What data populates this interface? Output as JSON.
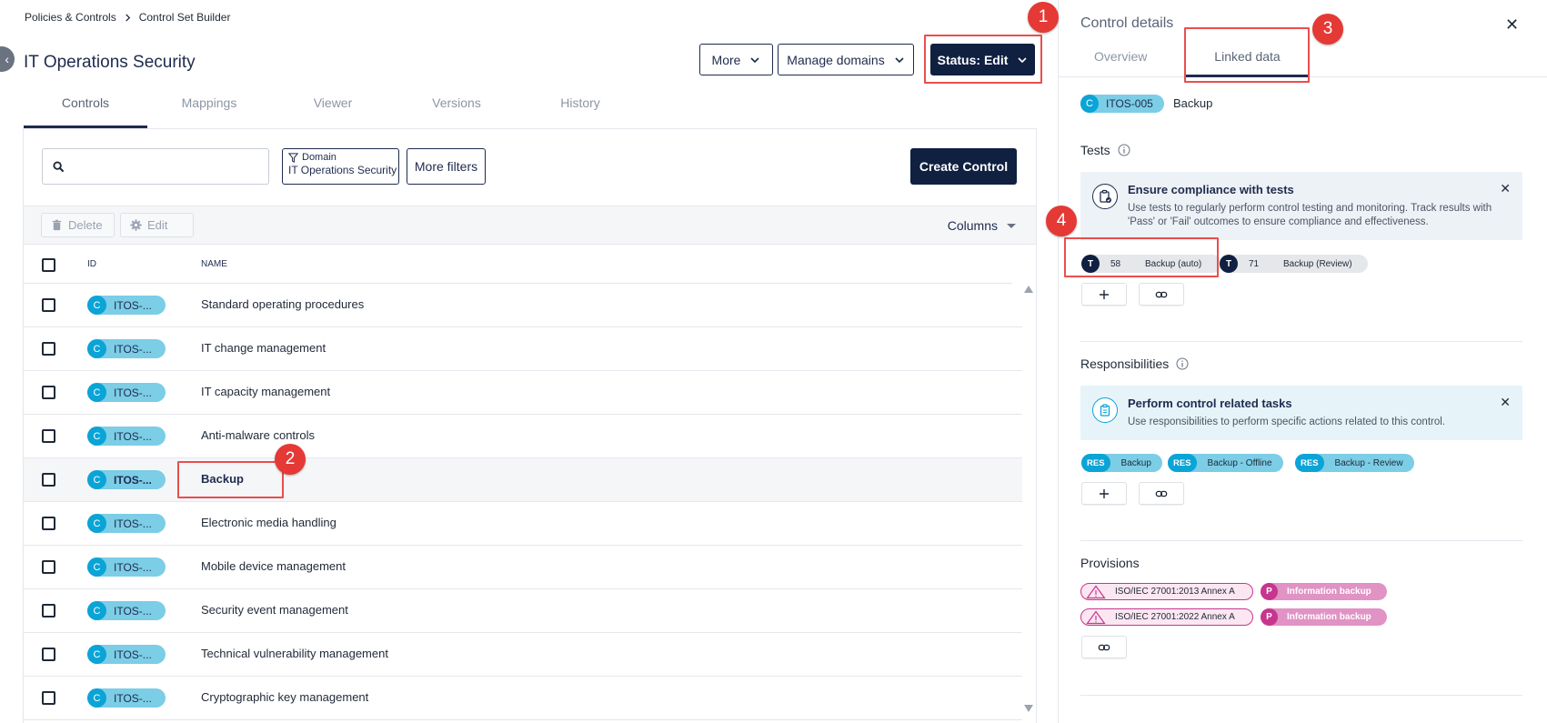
{
  "breadcrumb": [
    "Policies & Controls",
    "Control Set Builder"
  ],
  "page_title": "IT Operations Security",
  "header_buttons": {
    "more": "More",
    "manage_domains": "Manage domains",
    "status": "Status: Edit"
  },
  "tabs": [
    "Controls",
    "Mappings",
    "Viewer",
    "Versions",
    "History"
  ],
  "active_tab": "Controls",
  "search": {
    "value": "",
    "placeholder": ""
  },
  "domain_filter": {
    "label": "Domain",
    "value": "IT Operations Security"
  },
  "more_filters": "More filters",
  "create_control": "Create Control",
  "toolbar": {
    "delete": "Delete",
    "edit": "Edit",
    "columns": "Columns"
  },
  "table": {
    "columns": [
      "ID",
      "NAME"
    ],
    "rows": [
      {
        "badge": "C",
        "id": "ITOS-...",
        "name": "Standard operating procedures"
      },
      {
        "badge": "C",
        "id": "ITOS-...",
        "name": "IT change management"
      },
      {
        "badge": "C",
        "id": "ITOS-...",
        "name": "IT capacity management"
      },
      {
        "badge": "C",
        "id": "ITOS-...",
        "name": "Anti-malware controls"
      },
      {
        "badge": "C",
        "id": "ITOS-...",
        "name": "Backup",
        "selected": true
      },
      {
        "badge": "C",
        "id": "ITOS-...",
        "name": "Electronic media handling"
      },
      {
        "badge": "C",
        "id": "ITOS-...",
        "name": "Mobile device management"
      },
      {
        "badge": "C",
        "id": "ITOS-...",
        "name": "Security event management"
      },
      {
        "badge": "C",
        "id": "ITOS-...",
        "name": "Technical vulnerability management"
      },
      {
        "badge": "C",
        "id": "ITOS-...",
        "name": "Cryptographic key management"
      }
    ]
  },
  "detail": {
    "title": "Control details",
    "tabs": [
      "Overview",
      "Linked data"
    ],
    "active_tab": "Linked data",
    "control": {
      "badge": "C",
      "id": "ITOS-005",
      "name": "Backup"
    },
    "tests": {
      "title": "Tests",
      "callout_title": "Ensure compliance with tests",
      "callout_desc": "Use tests to regularly perform control testing and monitoring. Track results with 'Pass' or 'Fail' outcomes to ensure compliance and effectiveness.",
      "items": [
        {
          "badge": "T",
          "num": "58",
          "name": "Backup (auto)"
        },
        {
          "badge": "T",
          "num": "71",
          "name": "Backup (Review)"
        }
      ]
    },
    "responsibilities": {
      "title": "Responsibilities",
      "callout_title": "Perform control related tasks",
      "callout_desc": "Use responsibilities to perform specific actions related to this control.",
      "items": [
        {
          "badge": "RES",
          "name": "Backup"
        },
        {
          "badge": "RES",
          "name": "Backup - Offline"
        },
        {
          "badge": "RES",
          "name": "Backup - Review"
        }
      ]
    },
    "provisions": {
      "title": "Provisions",
      "items": [
        {
          "standard": "ISO/IEC 27001:2013 Annex A",
          "badge": "P",
          "name": "Information backup"
        },
        {
          "standard": "ISO/IEC 27001:2022 Annex A",
          "badge": "P",
          "name": "Information backup"
        }
      ]
    }
  },
  "annotations": [
    "1",
    "2",
    "3",
    "4"
  ],
  "colors": {
    "navy": "#0f2041",
    "control_pill": "#7ccde6",
    "control_badge": "#0aa4d6",
    "provision": "#c7368e",
    "annotation": "#e53935"
  }
}
